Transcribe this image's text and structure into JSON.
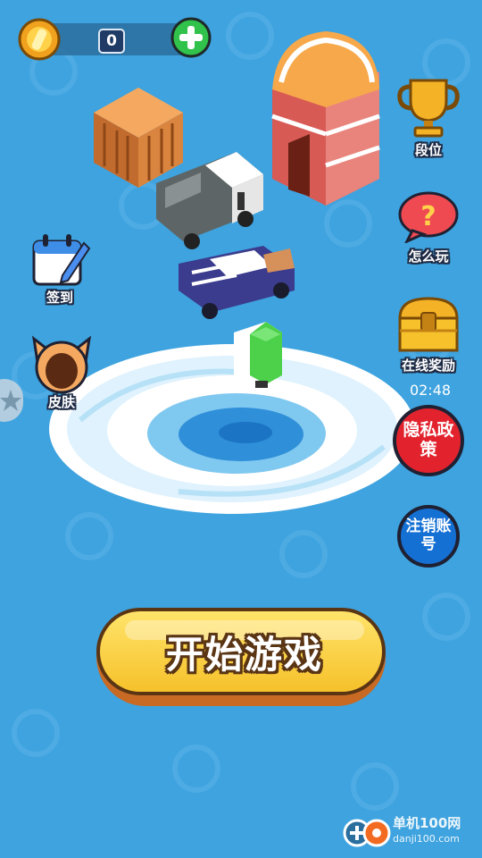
{
  "hud": {
    "coins": "0",
    "add_coins_icon": "plus-icon",
    "coin_icon": "gold-coin-icon"
  },
  "menu": {
    "rank_label": "段位",
    "how_to_play_label": "怎么玩",
    "online_reward_label": "在线奖励",
    "online_reward_timer": "02:48",
    "checkin_label": "签到",
    "skin_label": "皮肤",
    "privacy_policy_label": "隐私政策",
    "delete_account_label": "注销账号"
  },
  "start_button": {
    "label": "开始游戏"
  },
  "watermark": {
    "site": "单机100网",
    "url": "danji100.com"
  },
  "colors": {
    "background": "#3ea3df",
    "start_button": "#f6c12b",
    "privacy_button": "#e2232e",
    "account_button": "#1570d4"
  }
}
